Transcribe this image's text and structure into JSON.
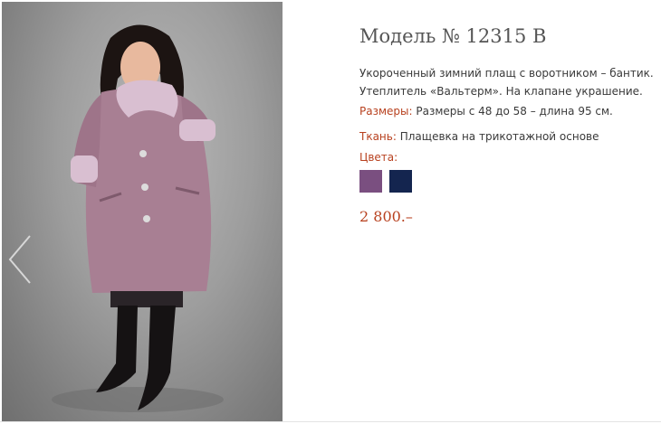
{
  "product": {
    "title": "Модель № 12315 В",
    "description_line1": "Укороченный зимний плащ с воротником – бантик.",
    "description_line2": "Утеплитель «Вальтерм». На клапане украшение.",
    "sizes_label": "Размеры:",
    "sizes_value": "Размеры с 48 до 58 – длина 95 см.",
    "fabric_label": "Ткань:",
    "fabric_value": "Плащевка на трикотажной основе",
    "colors_label": "Цвета:",
    "colors": [
      {
        "name": "purple",
        "hex": "#7a4f80"
      },
      {
        "name": "navy",
        "hex": "#14254f"
      }
    ],
    "price": "2 800.–"
  },
  "gallery": {
    "prev_arrow_icon": "chevron-left-icon",
    "coat_color": "#a87f93",
    "fur_color": "#d9bfd1"
  },
  "theme": {
    "accent": "#b8411f",
    "title_color": "#555555"
  }
}
